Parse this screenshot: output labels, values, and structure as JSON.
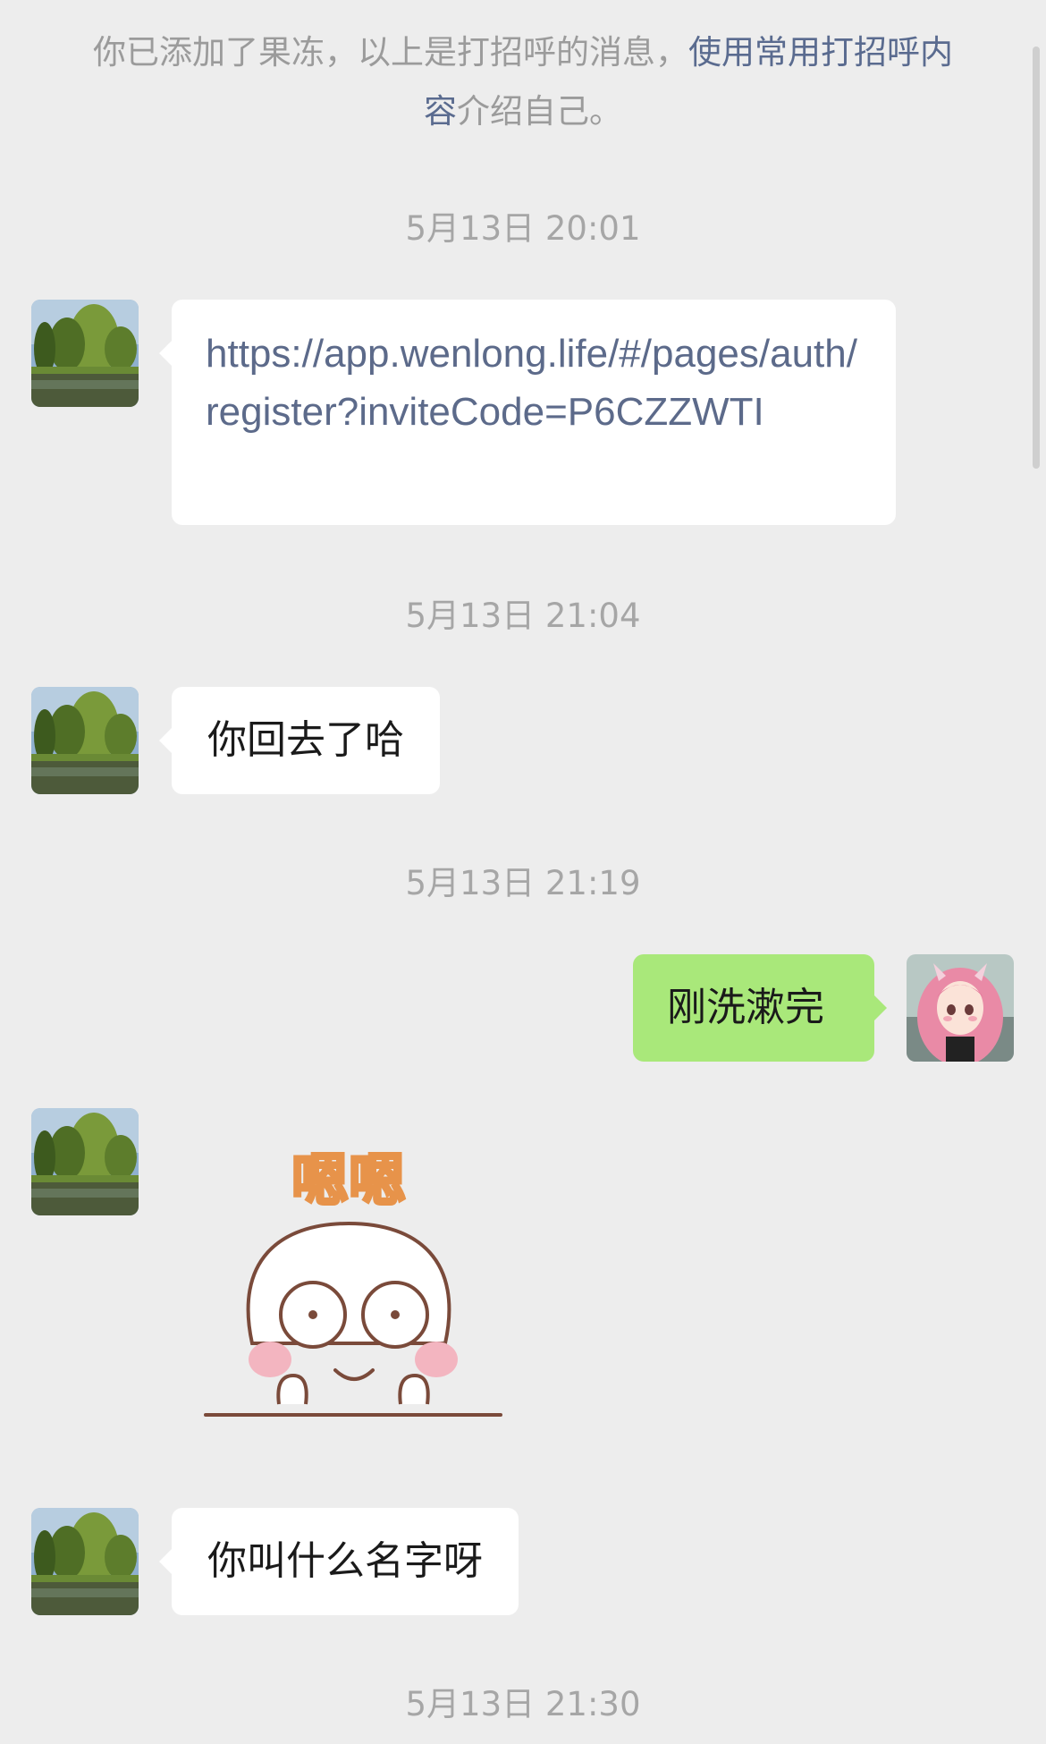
{
  "system_notice": {
    "prefix": "你已添加了果冻，以上是打招呼的消息，",
    "link": "使用常用打招呼内容",
    "suffix": "介绍自己。"
  },
  "messages": [
    {
      "type": "timestamp",
      "text": "5月13日 20:01"
    },
    {
      "type": "text",
      "side": "left",
      "text": "https://app.wenlong.life/#/pages/auth/register?inviteCode=P6CZZWTI"
    },
    {
      "type": "timestamp",
      "text": "5月13日 21:04"
    },
    {
      "type": "text",
      "side": "left",
      "text": "你回去了哈"
    },
    {
      "type": "timestamp",
      "text": "5月13日 21:19"
    },
    {
      "type": "text",
      "side": "right",
      "text": "刚洗漱完"
    },
    {
      "type": "sticker",
      "side": "left",
      "caption": "嗯嗯"
    },
    {
      "type": "text",
      "side": "left",
      "text": "你叫什么名字呀"
    },
    {
      "type": "timestamp",
      "text": "5月13日 21:30"
    }
  ],
  "colors": {
    "background": "#ededed",
    "incoming_bubble": "#ffffff",
    "outgoing_bubble": "#a9e87a",
    "timestamp_text": "#a6a6a6",
    "link_text": "#5a6b8f",
    "url_text": "#5c6a8a"
  }
}
